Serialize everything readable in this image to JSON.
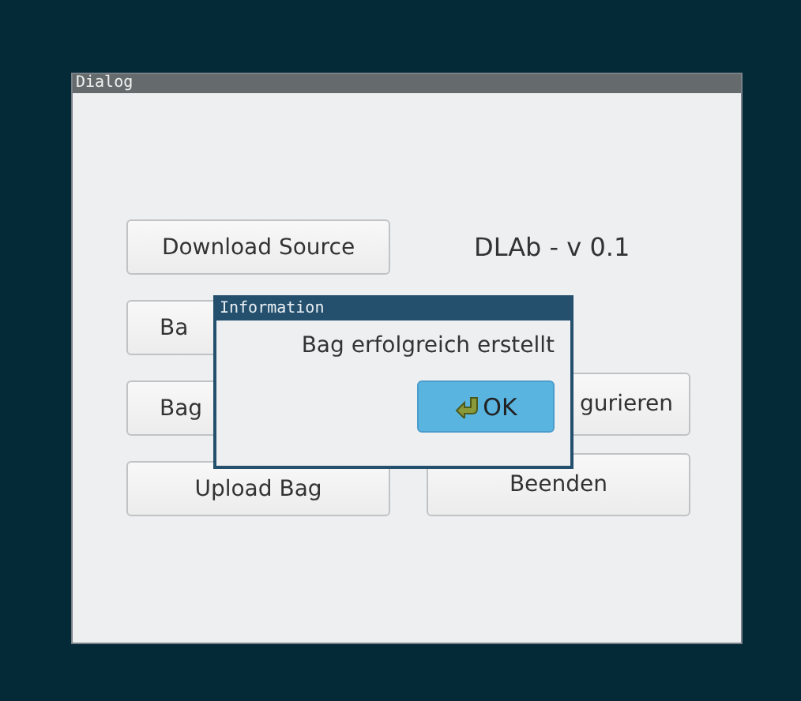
{
  "window": {
    "title": "Dialog"
  },
  "version_label": "DLAb - v 0.1",
  "buttons": [
    {
      "label": "Download Source"
    },
    {
      "label": "Ba"
    },
    {
      "label": "Bag"
    },
    {
      "label": "gurieren"
    },
    {
      "label": "Upload Bag"
    },
    {
      "label": "Beenden"
    }
  ],
  "message_box": {
    "title": "Information",
    "message": "Bag erfolgreich erstellt",
    "button": "OK"
  }
}
